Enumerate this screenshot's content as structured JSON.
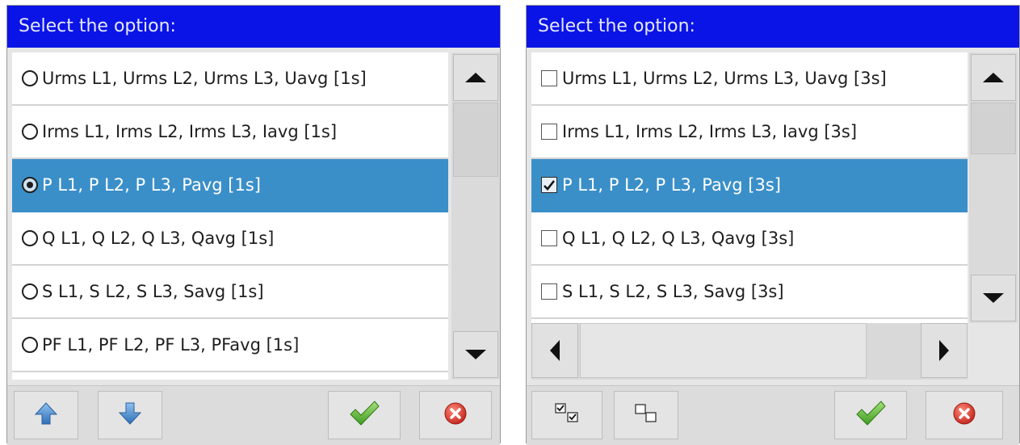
{
  "colors": {
    "title_bar": "#0a14e6",
    "selection": "#3a8fc8",
    "ok_green": "#5fbf3a",
    "cancel_red": "#d9342a",
    "arrow_blue": "#4e93d6"
  },
  "left_dialog": {
    "title": "Select the option:",
    "control_type": "radio",
    "items": [
      {
        "label": "Urms L1, Urms L2, Urms L3, Uavg [1s]",
        "checked": false,
        "highlighted": false
      },
      {
        "label": "Irms L1, Irms L2, Irms L3, Iavg [1s]",
        "checked": false,
        "highlighted": false
      },
      {
        "label": "P L1, P L2, P L3, Pavg [1s]",
        "checked": true,
        "highlighted": true
      },
      {
        "label": "Q L1, Q L2, Q L3, Qavg [1s]",
        "checked": false,
        "highlighted": false
      },
      {
        "label": "S L1, S L2, S L3, Savg [1s]",
        "checked": false,
        "highlighted": false
      },
      {
        "label": "PF L1, PF L2, PF L3, PFavg [1s]",
        "checked": false,
        "highlighted": false
      }
    ],
    "buttons": {
      "move_up_icon": "arrow-up-icon",
      "move_down_icon": "arrow-down-icon",
      "ok_icon": "checkmark-icon",
      "cancel_icon": "cancel-icon"
    }
  },
  "right_dialog": {
    "title": "Select the option:",
    "control_type": "checkbox",
    "items": [
      {
        "label": "Urms L1, Urms L2, Urms L3, Uavg [3s]",
        "checked": false,
        "highlighted": false
      },
      {
        "label": "Irms L1, Irms L2, Irms L3, Iavg [3s]",
        "checked": false,
        "highlighted": false
      },
      {
        "label": "P L1, P L2, P L3, Pavg [3s]",
        "checked": true,
        "highlighted": true
      },
      {
        "label": "Q L1, Q L2, Q L3, Qavg [3s]",
        "checked": false,
        "highlighted": false
      },
      {
        "label": "S L1, S L2, S L3, Savg [3s]",
        "checked": false,
        "highlighted": false
      }
    ],
    "buttons": {
      "select_all_icon": "select-all-icon",
      "deselect_all_icon": "deselect-all-icon",
      "ok_icon": "checkmark-icon",
      "cancel_icon": "cancel-icon"
    }
  }
}
